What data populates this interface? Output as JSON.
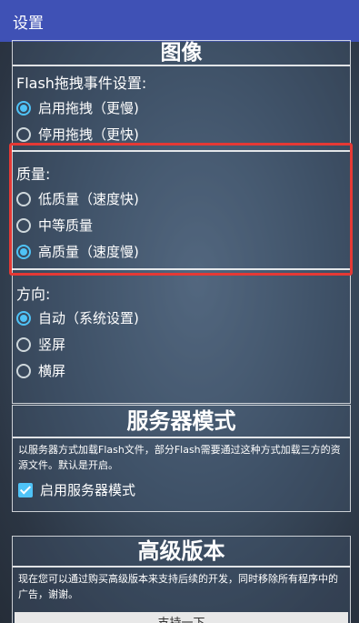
{
  "appbar": {
    "title": "设置"
  },
  "image_section": {
    "title": "图像",
    "drag_label": "Flash拖拽事件设置:",
    "drag_options": [
      {
        "label": "启用拖拽（更慢)",
        "selected": true
      },
      {
        "label": "停用拖拽（更快)",
        "selected": false
      }
    ],
    "quality_label": "质量:",
    "quality_options": [
      {
        "label": "低质量（速度快)",
        "selected": false
      },
      {
        "label": "中等质量",
        "selected": false
      },
      {
        "label": "高质量（速度慢)",
        "selected": true
      }
    ],
    "orientation_label": "方向:",
    "orientation_options": [
      {
        "label": "自动（系统设置)",
        "selected": true
      },
      {
        "label": "竖屏",
        "selected": false
      },
      {
        "label": "横屏",
        "selected": false
      }
    ]
  },
  "server_section": {
    "title": "服务器模式",
    "description": "以服务器方式加载Flash文件，部分Flash需要通过这种方式加载三方的资源文件。默认是开启。",
    "checkbox_label": "启用服务器模式",
    "checked": true
  },
  "premium_section": {
    "title": "高级版本",
    "description": "现在您可以通过购买高级版本来支持后续的开发，同时移除所有程序中的广告，谢谢。",
    "button_label": "支持一下"
  },
  "colors": {
    "appbar": "#3f51b5",
    "accent": "#4fc3f7",
    "highlight": "#e53935"
  }
}
